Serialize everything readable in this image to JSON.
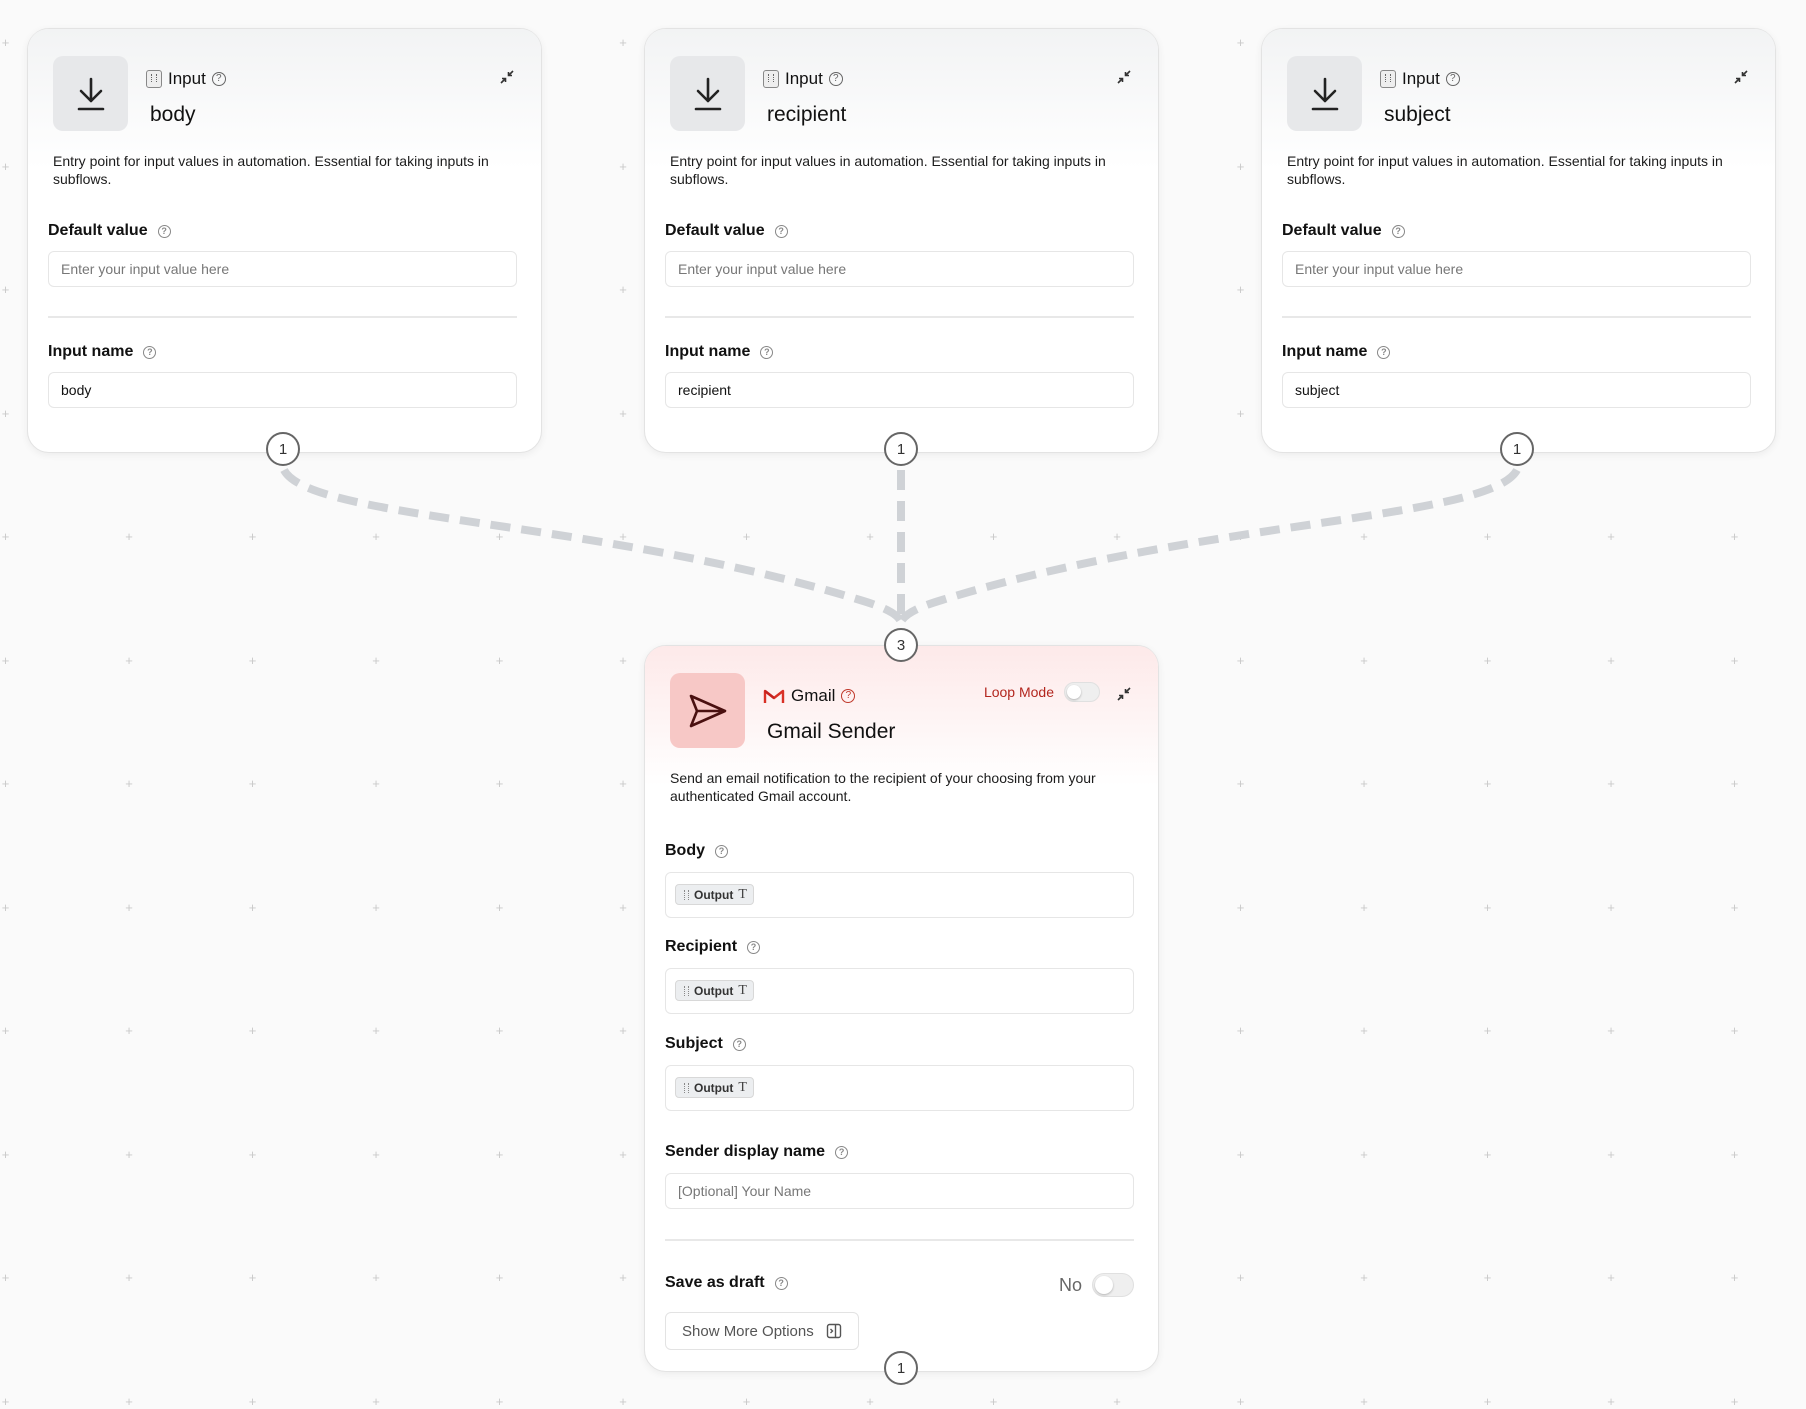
{
  "input_nodes": [
    {
      "kind": "Input",
      "title": "body",
      "description": "Entry point for input values in automation. Essential for taking inputs in subflows.",
      "default_value_label": "Default value",
      "default_value_placeholder": "Enter your input value here",
      "input_name_label": "Input name",
      "input_name_value": "body",
      "output_port": "1"
    },
    {
      "kind": "Input",
      "title": "recipient",
      "description": "Entry point for input values in automation. Essential for taking inputs in subflows.",
      "default_value_label": "Default value",
      "default_value_placeholder": "Enter your input value here",
      "input_name_label": "Input name",
      "input_name_value": "recipient",
      "output_port": "1"
    },
    {
      "kind": "Input",
      "title": "subject",
      "description": "Entry point for input values in automation. Essential for taking inputs in subflows.",
      "default_value_label": "Default value",
      "default_value_placeholder": "Enter your input value here",
      "input_name_label": "Input name",
      "input_name_value": "subject",
      "output_port": "1"
    }
  ],
  "gmail_node": {
    "kind": "Gmail",
    "title": "Gmail Sender",
    "loop_mode_label": "Loop Mode",
    "description": "Send an email notification to the recipient of your choosing from your authenticated Gmail account.",
    "input_port": "3",
    "output_port": "1",
    "fields": [
      {
        "label": "Body",
        "chip": "Output"
      },
      {
        "label": "Recipient",
        "chip": "Output"
      },
      {
        "label": "Subject",
        "chip": "Output"
      }
    ],
    "sender_label": "Sender display name",
    "sender_placeholder": "[Optional] Your Name",
    "save_draft_label": "Save as draft",
    "save_draft_value": "No",
    "show_more_label": "Show More Options"
  },
  "colors": {
    "accent_red": "#b3261e",
    "edge": "#cfd2d6"
  },
  "icons": [
    "download-icon",
    "send-icon",
    "gmail-logo-icon",
    "help-icon",
    "collapse-icon",
    "panel-icon",
    "text-type-icon",
    "drag-grip-icon"
  ]
}
